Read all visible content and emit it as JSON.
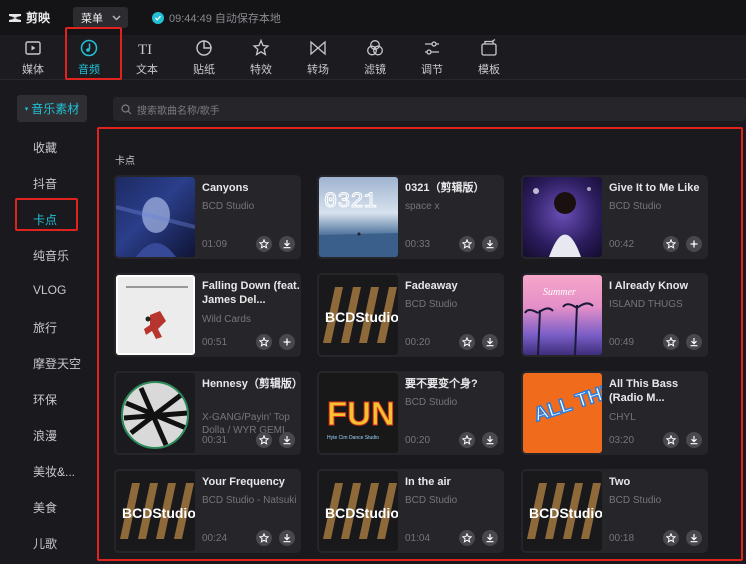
{
  "app": {
    "name": "剪映",
    "menu_label": "菜单",
    "save_status": "09:44:49 自动保存本地"
  },
  "toolbar": {
    "items": [
      {
        "label": "媒体",
        "icon": "media-icon"
      },
      {
        "label": "音频",
        "icon": "audio-icon",
        "active": true
      },
      {
        "label": "文本",
        "icon": "text-icon"
      },
      {
        "label": "贴纸",
        "icon": "sticker-icon"
      },
      {
        "label": "特效",
        "icon": "effects-icon"
      },
      {
        "label": "转场",
        "icon": "transition-icon"
      },
      {
        "label": "滤镜",
        "icon": "filter-icon"
      },
      {
        "label": "调节",
        "icon": "adjust-icon"
      },
      {
        "label": "模板",
        "icon": "template-icon"
      }
    ]
  },
  "sidebar": {
    "header": "音乐素材",
    "items": [
      "收藏",
      "抖音",
      "卡点",
      "纯音乐",
      "VLOG",
      "旅行",
      "摩登天空",
      "环保",
      "浪漫",
      "美妆&...",
      "美食",
      "儿歌"
    ],
    "active_index": 2
  },
  "search": {
    "placeholder": "搜索歌曲名称/歌手"
  },
  "section": {
    "title": "卡点"
  },
  "bcd_logo_text": "BCDStudio",
  "thumb_texts": {
    "c0321": "0321",
    "fun": "FUN",
    "fun_sub": "Hyte Cim Dance Studio",
    "summer": "Summer",
    "all_this_bass": "ALL THIS BASS"
  },
  "tracks": [
    {
      "title": "Canyons",
      "artist": "BCD Studio",
      "duration": "01:09",
      "action2": "download-icon"
    },
    {
      "title": "0321（剪辑版）",
      "artist": "space x",
      "duration": "00:33",
      "action2": "download-icon"
    },
    {
      "title": "Give It to Me Like",
      "artist": "BCD Studio",
      "duration": "00:42",
      "action2": "plus-icon"
    },
    {
      "title": "Falling Down (feat. James Del...",
      "artist": "Wild Cards",
      "duration": "00:51",
      "action2": "plus-icon"
    },
    {
      "title": "Fadeaway",
      "artist": "BCD Studio",
      "duration": "00:20",
      "action2": "download-icon"
    },
    {
      "title": "I Already Know",
      "artist": "ISLAND THUGS",
      "duration": "00:49",
      "action2": "download-icon"
    },
    {
      "title": "Hennesy（剪辑版）",
      "artist": "X-GANG/Payin' Top Dolla / WYR GEMI",
      "duration": "00:31",
      "action2": "download-icon"
    },
    {
      "title": "要不要变个身?",
      "artist": "BCD Studio",
      "duration": "00:20",
      "action2": "download-icon"
    },
    {
      "title": "All This Bass (Radio M...",
      "artist": "CHYL",
      "duration": "03:20",
      "action2": "download-icon"
    },
    {
      "title": "Your Frequency",
      "artist": "BCD Studio - Natsuki",
      "duration": "00:24",
      "action2": "download-icon"
    },
    {
      "title": "In the air",
      "artist": "BCD Studio",
      "duration": "01:04",
      "action2": "download-icon"
    },
    {
      "title": "Two",
      "artist": "BCD Studio",
      "duration": "00:18",
      "action2": "download-icon"
    }
  ],
  "colors": {
    "accent": "#22c1d6",
    "highlight": "#e0231f",
    "background": "#1a1a1e"
  }
}
